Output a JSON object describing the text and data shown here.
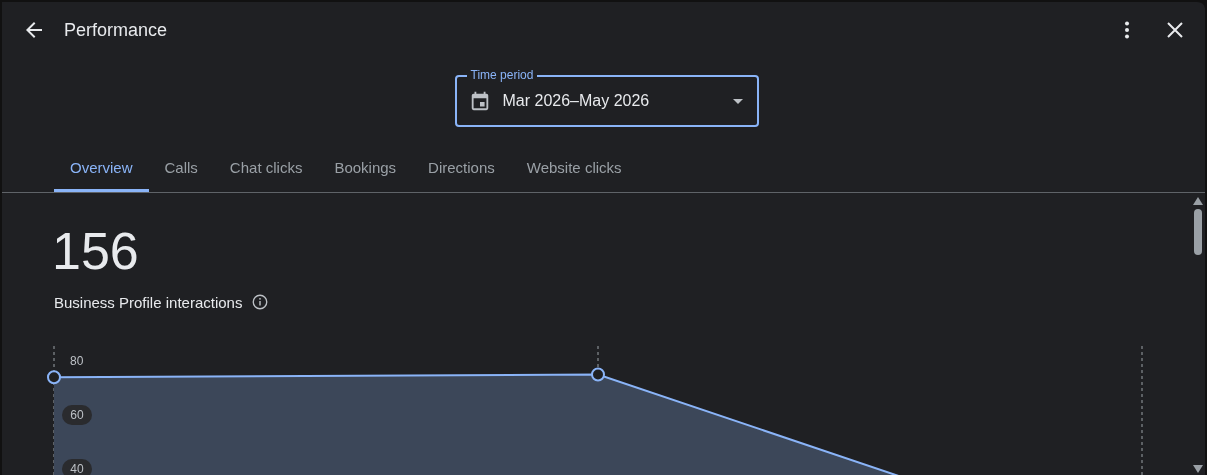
{
  "header": {
    "title": "Performance"
  },
  "time_period": {
    "label": "Time period",
    "value": "Mar 2026–May 2026"
  },
  "tabs": [
    {
      "label": "Overview",
      "selected": true
    },
    {
      "label": "Calls",
      "selected": false
    },
    {
      "label": "Chat clicks",
      "selected": false
    },
    {
      "label": "Bookings",
      "selected": false
    },
    {
      "label": "Directions",
      "selected": false
    },
    {
      "label": "Website clicks",
      "selected": false
    }
  ],
  "summary": {
    "value": "156",
    "label": "Business Profile interactions"
  },
  "chart_data": {
    "type": "area",
    "ylim": [
      0,
      80
    ],
    "yticks": [
      40,
      60,
      80
    ],
    "grid": true,
    "series": [
      {
        "color": "#8ab4f8",
        "values": [
          74,
          75,
          7
        ]
      }
    ]
  }
}
